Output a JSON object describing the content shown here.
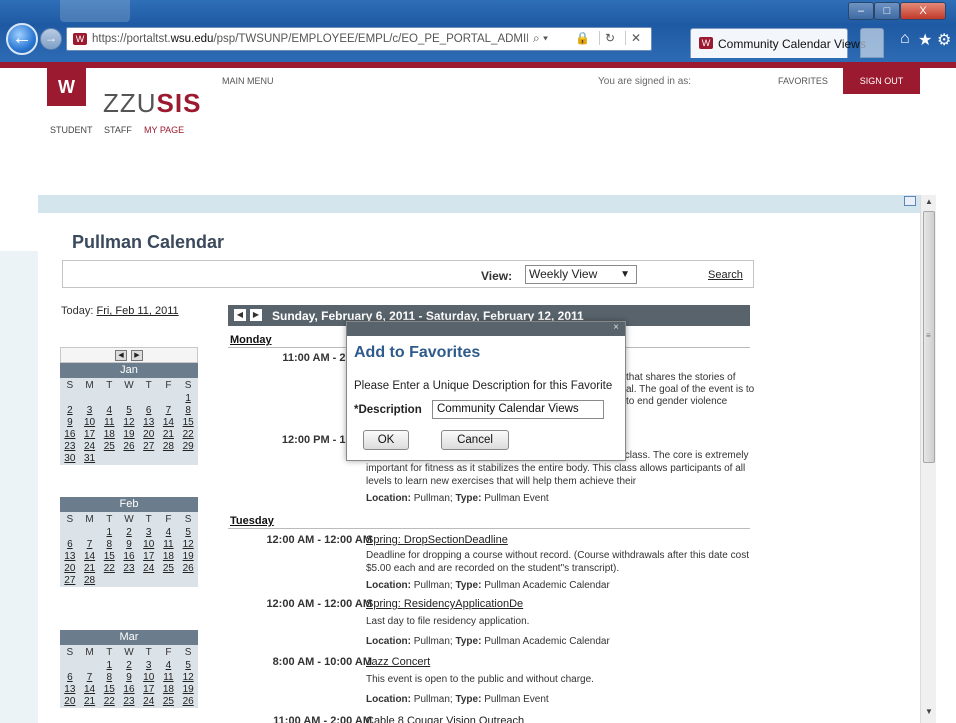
{
  "browser": {
    "url_prefix": "https://portaltst.",
    "url_domain": "wsu.edu",
    "url_path": "/psp/TWSUNP/EMPLOYEE/EMPL/c/EO_PE_PORTAL_ADMIN.EPPCA_C",
    "tab_title": "Community Calendar Views",
    "window_buttons": {
      "minimize": "‒",
      "maximize": "□",
      "close": "X"
    }
  },
  "header": {
    "logo_text_plain": "ZZU",
    "logo_text_bold": "SIS",
    "main_menu": "MAIN MENU",
    "signed_in": "You are signed in as:",
    "favorites": "FAVORITES",
    "sign_out": "SIGN OUT",
    "nav": [
      "STUDENT",
      "STAFF",
      "MY PAGE"
    ]
  },
  "page": {
    "title": "Pullman Calendar",
    "view_label": "View:",
    "view_value": "Weekly View",
    "search": "Search",
    "today_label": "Today:",
    "today_value": "Fri, Feb 11, 2011"
  },
  "mini_calendars": {
    "day_names": [
      "S",
      "M",
      "T",
      "W",
      "T",
      "F",
      "S"
    ],
    "months": [
      {
        "name": "Jan",
        "days": [
          "",
          "",
          "",
          "",
          "",
          "",
          "1",
          "2",
          "3",
          "4",
          "5",
          "6",
          "7",
          "8",
          "9",
          "10",
          "11",
          "12",
          "13",
          "14",
          "15",
          "16",
          "17",
          "18",
          "19",
          "20",
          "21",
          "22",
          "23",
          "24",
          "25",
          "26",
          "27",
          "28",
          "29",
          "30",
          "31"
        ]
      },
      {
        "name": "Feb",
        "days": [
          "",
          "",
          "1",
          "2",
          "3",
          "4",
          "5",
          "6",
          "7",
          "8",
          "9",
          "10",
          "11",
          "12",
          "13",
          "14",
          "15",
          "16",
          "17",
          "18",
          "19",
          "20",
          "21",
          "22",
          "23",
          "24",
          "25",
          "26",
          "27",
          "28"
        ]
      },
      {
        "name": "Mar",
        "days": [
          "",
          "",
          "1",
          "2",
          "3",
          "4",
          "5",
          "6",
          "7",
          "8",
          "9",
          "10",
          "11",
          "12",
          "13",
          "14",
          "15",
          "16",
          "17",
          "18",
          "19",
          "20",
          "21",
          "22",
          "23",
          "24",
          "25",
          "26"
        ]
      }
    ]
  },
  "week": {
    "range": "Sunday, February 6, 2011 - Saturday, February 12, 2011",
    "monday": "Monday",
    "tuesday": "Tuesday",
    "events": {
      "mon1_time": "11:00 AM - 2:00 A",
      "mon1_desc1": "that shares the stories of",
      "mon1_desc2": "al. The goal of the event is to",
      "mon1_desc3": "to end gender violence",
      "mon2_time": "12:00 PM - 1:00 A",
      "mon2_desc1": "ss class. The core is extremely",
      "mon2_desc2": "important for fitness as it stabilizes the entire body. This class allows participants of all",
      "mon2_desc3": "levels to learn new exercises that will help them achieve their",
      "mon2_loc": "Pullman",
      "mon2_type": "Pullman Event",
      "tue1_time": "12:00 AM - 12:00 AM",
      "tue1_title": "Spring: DropSectionDeadline",
      "tue1_desc1": "Deadline for dropping a course without record. (Course withdrawals after this date cost",
      "tue1_desc2": "$5.00 each and are recorded on the student\"s transcript).",
      "tue1_loc": "Pullman",
      "tue1_type": "Pullman Academic Calendar",
      "tue2_time": "12:00 AM - 12:00 AM",
      "tue2_title": "Spring: ResidencyApplicationDe",
      "tue2_desc": "Last day to file residency application.",
      "tue2_loc": "Pullman",
      "tue2_type": "Pullman Academic Calendar",
      "tue3_time": "8:00 AM - 10:00 AM",
      "tue3_title": "Jazz Concert",
      "tue3_desc": "This event is open to the public and without charge.",
      "tue3_loc": "Pullman",
      "tue3_type": "Pullman Event",
      "tue4_time": "11:00 AM - 2:00 AM",
      "tue4_title": "Cable 8 Cougar Vision Outreach"
    },
    "loc_label": "Location:",
    "type_label": "Type:"
  },
  "modal": {
    "title": "Add to Favorites",
    "prompt": "Please Enter a Unique Description for this Favorite",
    "label": "*Description",
    "value": "Community Calendar Views",
    "ok": "OK",
    "cancel": "Cancel",
    "close": "×"
  }
}
